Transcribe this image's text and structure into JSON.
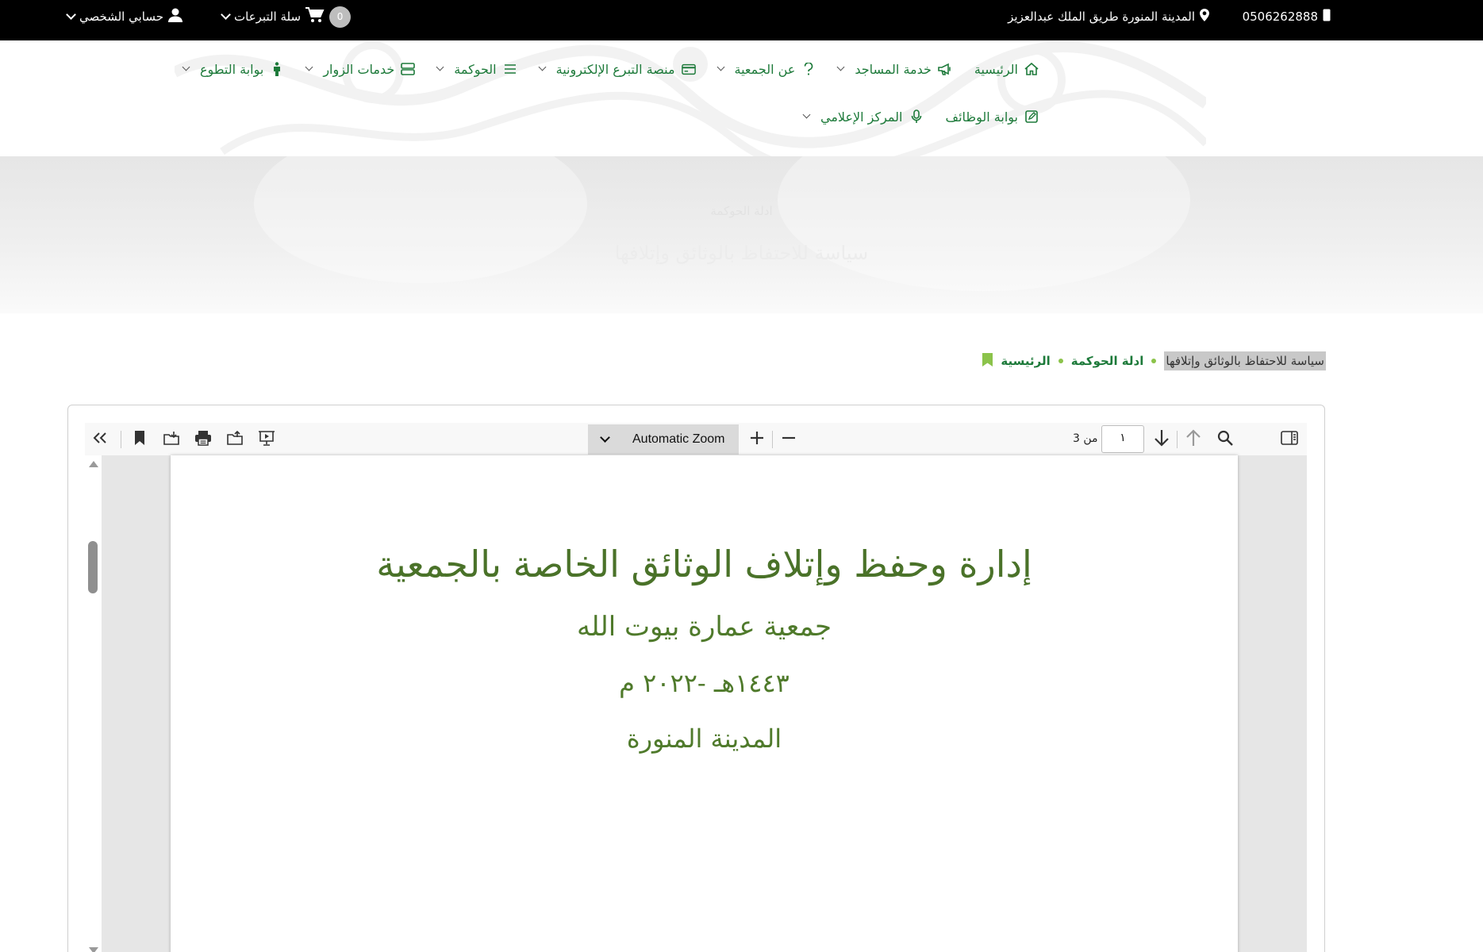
{
  "topbar": {
    "phone": "0506262888",
    "address": "المدينة المنورة طريق الملك عبدالعزيز",
    "cart_count": "0",
    "cart_label": "سلة التبرعات",
    "account_label": "حسابي الشخصي"
  },
  "nav": {
    "row1": [
      {
        "label": "الرئيسية",
        "icon": "home-icon",
        "dropdown": false
      },
      {
        "label": "خدمة المساجد",
        "icon": "megaphone-icon",
        "dropdown": true
      },
      {
        "label": "عن الجمعية",
        "icon": "question-icon",
        "dropdown": true
      },
      {
        "label": "منصة التبرع الإلكترونية",
        "icon": "card-icon",
        "dropdown": true
      },
      {
        "label": "الحوكمة",
        "icon": "list-icon",
        "dropdown": true
      },
      {
        "label": "خدمات الزوار",
        "icon": "server-icon",
        "dropdown": true
      },
      {
        "label": "بوابة التطوع",
        "icon": "person-icon",
        "dropdown": true
      }
    ],
    "row2": [
      {
        "label": "بوابة الوظائف",
        "icon": "edit-icon",
        "dropdown": false
      },
      {
        "label": "المركز الإعلامي",
        "icon": "microphone-icon",
        "dropdown": true
      }
    ]
  },
  "hero": {
    "subtitle": "ادلة الحوكمة",
    "title": "سياسة للاحتفاظ بالوثائق وإتلافها"
  },
  "breadcrumb": {
    "home": "الرئيسية",
    "section": "ادلة الحوكمة",
    "current": "سياسة للاحتفاظ بالوثائق وإتلافها"
  },
  "pdf": {
    "zoom": "Automatic Zoom",
    "page_number": "١",
    "page_of": "من 3",
    "document": {
      "title": "إدارة وحفظ وإتلاف الوثائق الخاصة بالجمعية",
      "organization": "جمعية عمارة بيوت الله",
      "date": "١٤٤٣هـ -٢٠٢٢ م",
      "city": "المدينة المنورة"
    }
  },
  "colors": {
    "brand_green": "#1d7a3a",
    "accent_lime": "#8bc34a",
    "doc_green": "#4f7a2b",
    "topbar_bg": "#000000"
  }
}
